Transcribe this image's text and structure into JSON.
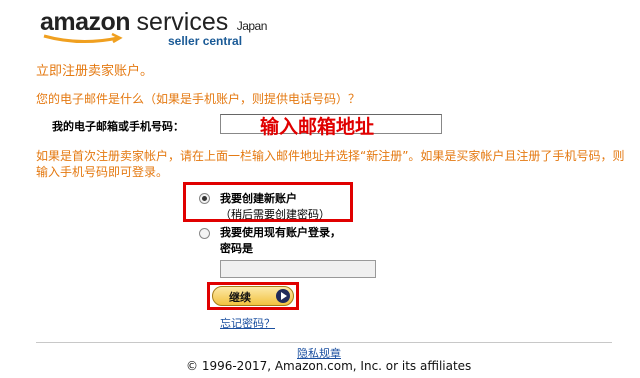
{
  "logo": {
    "brand": "amazon",
    "services": "services",
    "region": "Japan",
    "subtitle": "seller central"
  },
  "page_title": "立即注册卖家账户。",
  "question": "您的电子邮件是什么（如果是手机账户，则提供电话号码）？",
  "email": {
    "label": "我的电子邮箱或手机号码：",
    "annotation": "输入邮箱地址"
  },
  "note": "如果是首次注册卖家帐户，请在上面一栏输入邮件地址并选择“新注册”。如果是买家帐户且注册了手机号码，则输入手机号码即可登录。",
  "options": {
    "new_account": {
      "label": "我要创建新账户",
      "sub": "（稍后需要创建密码）",
      "selected": true
    },
    "existing_account": {
      "label": "我要使用现有账户登录，",
      "sub": "密码是",
      "selected": false
    }
  },
  "buttons": {
    "continue": "继续"
  },
  "links": {
    "forgot_password": "忘记密码？",
    "privacy": "隐私规章"
  },
  "footer": {
    "copyright": "© 1996-2017, Amazon.com, Inc. or its affiliates"
  },
  "colors": {
    "orange": "#e47911",
    "highlight_red": "#e00000",
    "link_blue": "#1a4fa0"
  }
}
